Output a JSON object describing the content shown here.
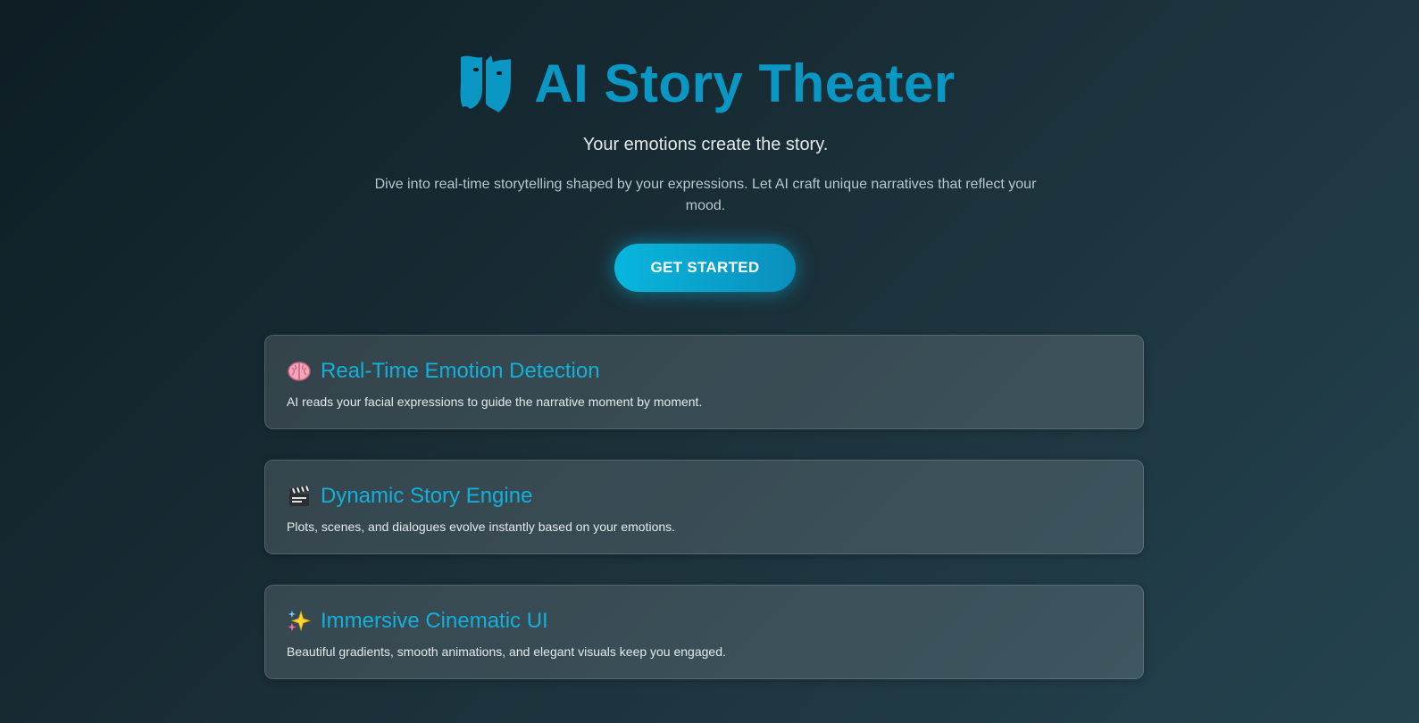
{
  "hero": {
    "title": "AI Story Theater",
    "logo_icon": "theater-mask-icon",
    "tagline": "Your emotions create the story.",
    "description": "Dive into real-time storytelling shaped by your expressions. Let AI craft unique narratives that reflect your mood.",
    "cta_label": "GET STARTED"
  },
  "features": [
    {
      "icon": "brain-icon",
      "title": "Real-Time Emotion Detection",
      "text": "AI reads your facial expressions to guide the narrative moment by moment."
    },
    {
      "icon": "clapper-board-icon",
      "title": "Dynamic Story Engine",
      "text": "Plots, scenes, and dialogues evolve instantly based on your emotions."
    },
    {
      "icon": "sparkles-icon",
      "title": "Immersive Cinematic UI",
      "text": "Beautiful gradients, smooth animations, and elegant visuals keep you engaged."
    }
  ],
  "colors": {
    "accent": "#0b97c4",
    "button_start": "#08b6dd",
    "button_end": "#0a8fbd",
    "card_title": "#12b1dc"
  }
}
